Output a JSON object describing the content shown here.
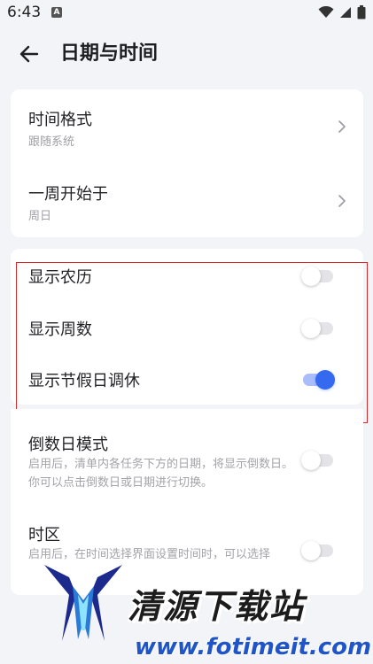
{
  "status_bar": {
    "time": "6:43",
    "notification_icon_text": "A"
  },
  "header": {
    "title": "日期与时间"
  },
  "settings": {
    "time_format": {
      "title": "时间格式",
      "value": "跟随系统"
    },
    "week_start": {
      "title": "一周开始于",
      "value": "周日"
    },
    "show_lunar": {
      "title": "显示农历",
      "enabled": false
    },
    "show_week_number": {
      "title": "显示周数",
      "enabled": false
    },
    "show_holidays": {
      "title": "显示节假日调休",
      "enabled": true
    },
    "countdown_mode": {
      "title": "倒数日模式",
      "description": "启用后，清单内各任务下方的日期，将显示倒数日。你可以点击倒数日或日期进行切换。",
      "enabled": false
    },
    "time_zone": {
      "title": "时区",
      "description": "启用后，在时间选择界面设置时间时，可以选择",
      "enabled": false
    }
  },
  "watermark": {
    "name": "清源下载站",
    "url": "www.fotimeit.com"
  },
  "colors": {
    "accent": "#3469f0",
    "highlight_border": "#d42a2a",
    "background": "#f3f4f8"
  }
}
